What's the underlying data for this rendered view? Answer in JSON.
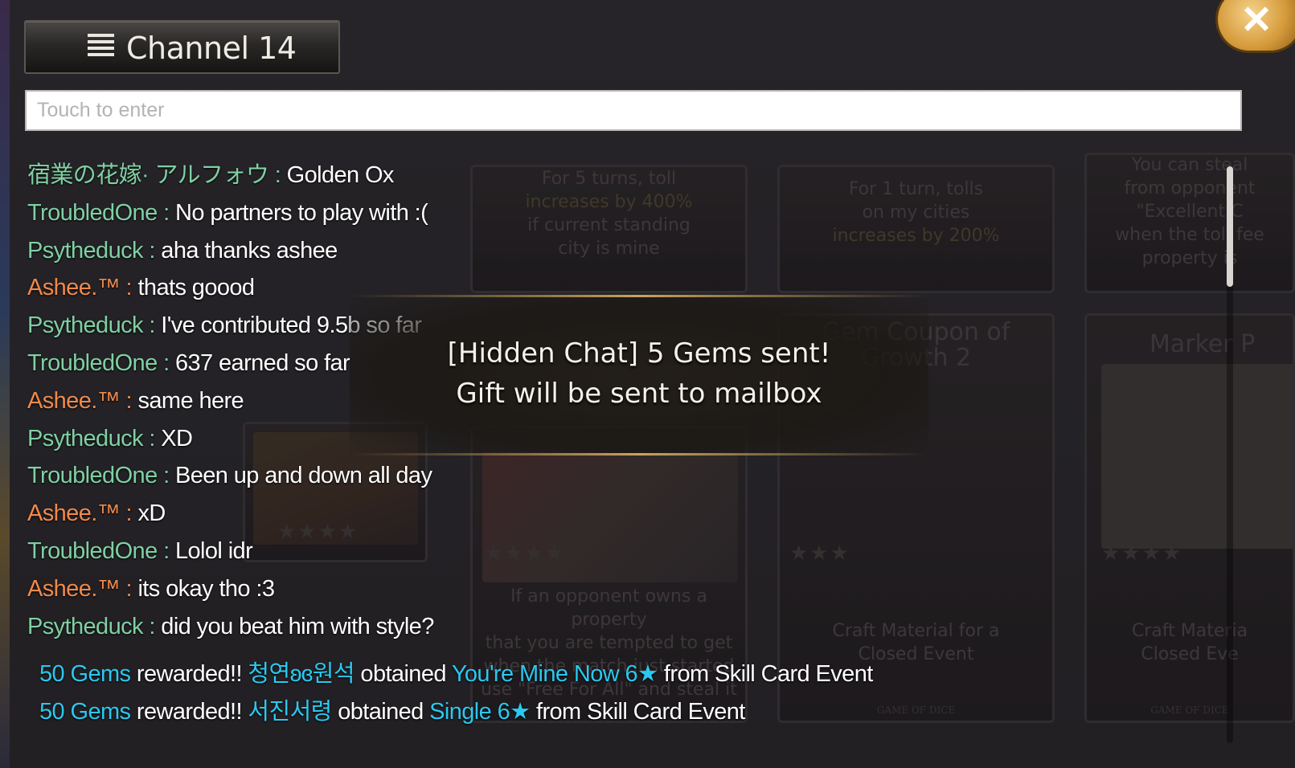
{
  "channel": {
    "title": "Channel 14",
    "icon": "menu-icon"
  },
  "close": {
    "icon": "close-icon",
    "glyph": "✕"
  },
  "input": {
    "placeholder": "Touch to enter"
  },
  "messages": [
    {
      "user": "宿業の花嫁· アルフォウ",
      "sep": " : ",
      "text": "Golden Ox"
    },
    {
      "user": "TroubledOne",
      "sep": " : ",
      "text": "No partners to play with :("
    },
    {
      "user": "Psytheduck",
      "sep": " : ",
      "text": "aha thanks ashee"
    },
    {
      "user": "Ashee.™",
      "sep": " : ",
      "text": "thats goood",
      "variant": "ashee"
    },
    {
      "user": "Psytheduck",
      "sep": " : ",
      "text": "I've contributed 9.5b so far"
    },
    {
      "user": "TroubledOne",
      "sep": " : ",
      "text": "637 earned so far"
    },
    {
      "user": "Ashee.™",
      "sep": " : ",
      "text": "same here",
      "variant": "ashee"
    },
    {
      "user": "Psytheduck",
      "sep": " : ",
      "text": "XD"
    },
    {
      "user": "TroubledOne",
      "sep": " : ",
      "text": "Been up and down all day"
    },
    {
      "user": "Ashee.™",
      "sep": " : ",
      "text": "xD",
      "variant": "ashee"
    },
    {
      "user": "TroubledOne",
      "sep": " : ",
      "text": "Lolol idr"
    },
    {
      "user": "Ashee.™",
      "sep": " : ",
      "text": "its okay tho :3",
      "variant": "ashee"
    },
    {
      "user": "Psytheduck",
      "sep": " : ",
      "text": "did you beat him with style?"
    }
  ],
  "system": [
    {
      "reward": "50 Gems",
      "rewarded": " rewarded!! ",
      "player": "청연ʚɞ원석",
      "obtained": " obtained ",
      "card": "You're Mine Now 6★",
      "source": " from Skill Card Event"
    },
    {
      "reward": "50 Gems",
      "rewarded": " rewarded!! ",
      "player": "서진서령",
      "obtained": " obtained ",
      "card": "Single 6★",
      "source": " from Skill Card Event"
    }
  ],
  "toast": {
    "line1": "[Hidden Chat] 5 Gems sent!",
    "line2": "Gift will be sent to mailbox"
  },
  "background_cards": {
    "card1": {
      "lines": [
        "For 5 turns, toll",
        "increases by 400%",
        "if current standing",
        "city is mine"
      ]
    },
    "card2": {
      "lines": [
        "For 1 turn, tolls",
        "on my cities",
        "increases by 200%"
      ]
    },
    "card3": {
      "lines": [
        "You can steal",
        "from opponent",
        "\"Excellent C",
        "when the toll fee",
        "property is"
      ]
    },
    "card4": {
      "title": [
        "Gem Coupon of",
        "Growth 2"
      ]
    },
    "card5": {
      "title": [
        "Marker P"
      ]
    },
    "card6": {
      "lines": [
        "If an opponent owns a",
        "property",
        "that you are tempted to get",
        "when the match just started",
        "use \"Free For All\" and steal it"
      ]
    },
    "card7": {
      "lines": [
        "Craft Material for a",
        "Closed Event"
      ]
    },
    "card8": {
      "lines": [
        "Craft Materia",
        "Closed Eve"
      ]
    },
    "footer": "GAME OF DICE"
  },
  "colors": {
    "username": "#7fd0a3",
    "ashee": "#f08a4c",
    "reward": "#2bc8f0",
    "toast_line": "#c9a45c"
  }
}
